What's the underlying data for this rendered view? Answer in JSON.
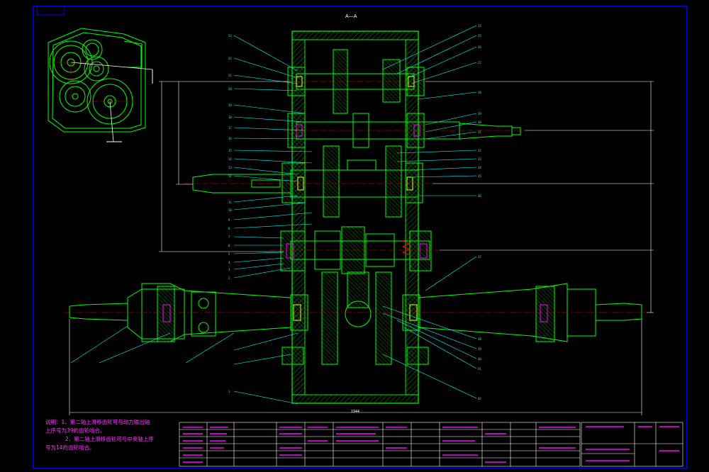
{
  "drawing": {
    "section_label": "A—A",
    "section_marker": "A",
    "overall_length_dim": "1944"
  },
  "notes": {
    "line1": "说明：1、第二轴上滑移齿轮可与动力输出轴",
    "line2": "上序号为39的齿轮啮合。",
    "line3": "2、第二轴上滑移齿轮可与中央轴上序",
    "line4": "号为14的齿轮啮合。"
  },
  "colors": {
    "background": "#000000",
    "frame": "#0000ff",
    "part_outline": "#00ff00",
    "leader": "#00ffff",
    "centerline": "#ff0000",
    "fastener": "#ffff00",
    "bearing": "#ff00ff",
    "dimension": "#ffffff"
  }
}
